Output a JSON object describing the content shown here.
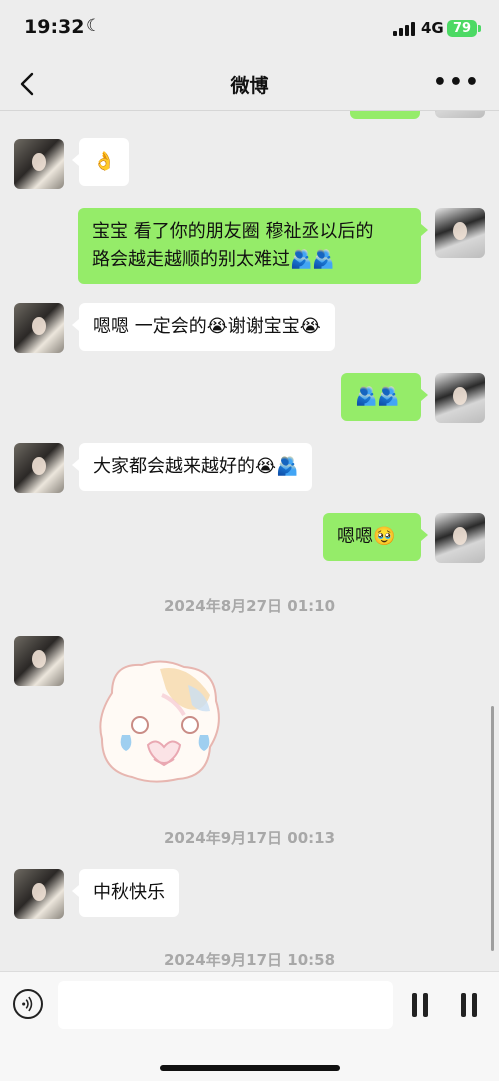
{
  "status_bar": {
    "time": "19:32",
    "network": "4G",
    "battery": "79"
  },
  "nav": {
    "title": "微博"
  },
  "messages": [
    {
      "side": "left",
      "text": "👌"
    },
    {
      "side": "right",
      "text": "宝宝 看了你的朋友圈 穆祉丞以后的\n路会越走越顺的别太难过🫂🫂"
    },
    {
      "side": "left",
      "text": "嗯嗯 一定会的😭谢谢宝宝😭"
    },
    {
      "side": "right",
      "text": "🫂🫂"
    },
    {
      "side": "left",
      "text": "大家都会越来越好的😭🫂"
    },
    {
      "side": "right",
      "text": "嗯嗯🥹"
    },
    {
      "side": "left",
      "text": "中秋快乐"
    }
  ],
  "timestamps": [
    "2024年8月27日 01:10",
    "2024年9月17日 00:13",
    "2024年9月17日 10:58"
  ],
  "colors": {
    "background": "#ededed",
    "bubble_self": "#95ec69",
    "bubble_other": "#ffffff"
  }
}
